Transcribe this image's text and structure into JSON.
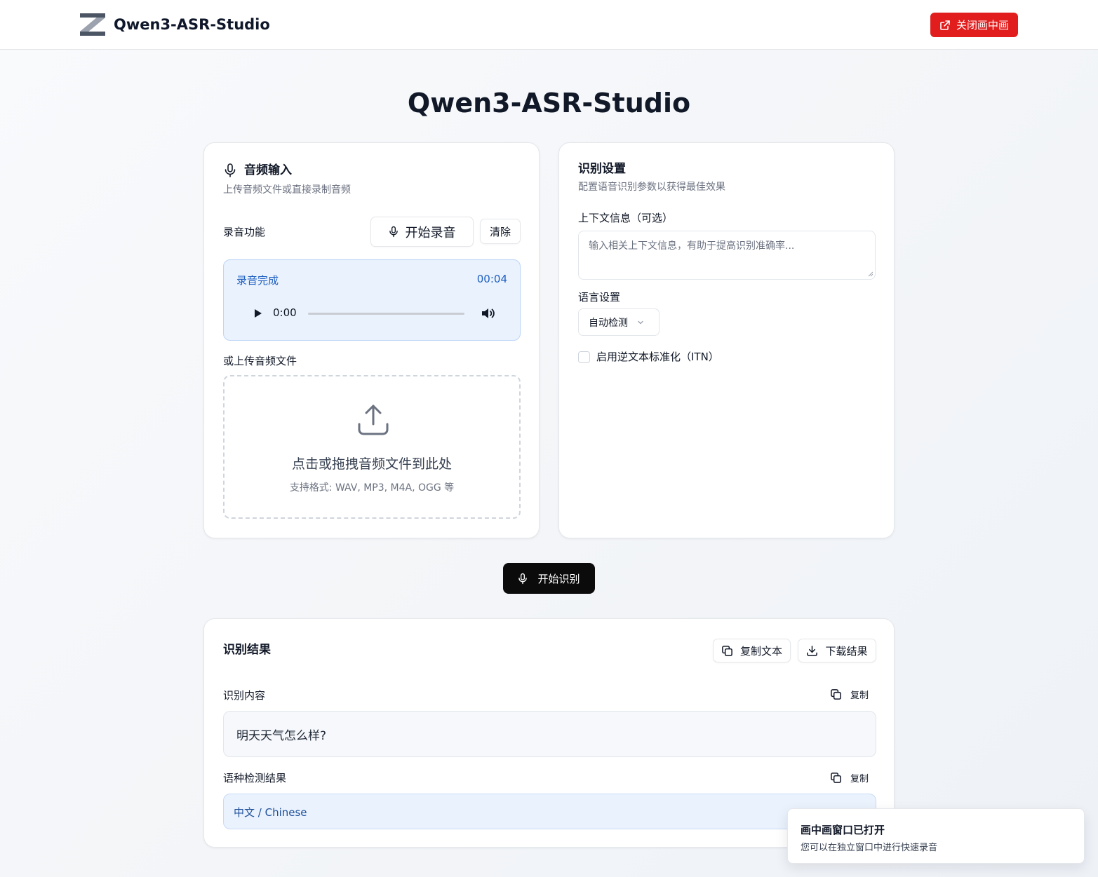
{
  "header": {
    "brand": "Qwen3-ASR-Studio",
    "pip_button": "关闭画中画",
    "logo_icon": "z-logo-icon"
  },
  "page": {
    "title": "Qwen3-ASR-Studio"
  },
  "audio_input": {
    "title": "音频输入",
    "subtitle": "上传音频文件或直接录制音频",
    "record_label": "录音功能",
    "start_record": "开始录音",
    "clear": "清除",
    "recording": {
      "status": "录音完成",
      "duration": "00:04",
      "player_time": "0:00"
    },
    "upload_label": "或上传音频文件",
    "dropzone_main": "点击或拖拽音频文件到此处",
    "dropzone_sub": "支持格式: WAV, MP3, M4A, OGG 等"
  },
  "settings": {
    "title": "识别设置",
    "subtitle": "配置语音识别参数以获得最佳效果",
    "context_label": "上下文信息（可选）",
    "context_placeholder": "输入相关上下文信息，有助于提高识别准确率...",
    "language_label": "语言设置",
    "language_value": "自动检测",
    "itn_label": "启用逆文本标准化（ITN）",
    "itn_checked": false
  },
  "recognize_button": "开始识别",
  "results": {
    "title": "识别结果",
    "copy_text": "复制文本",
    "download": "下载结果",
    "content_label": "识别内容",
    "content_copy": "复制",
    "content_text": "明天天气怎么样?",
    "lang_label": "语种检测结果",
    "lang_copy": "复制",
    "lang_text": "中文 / Chinese"
  },
  "toast": {
    "title": "画中画窗口已打开",
    "description": "您可以在独立窗口中进行快速录音"
  },
  "colors": {
    "primary_dark": "#0b0b0c",
    "danger": "#e11d1d",
    "info_bg": "#eaf2fd",
    "info_text": "#1d5fc1"
  }
}
